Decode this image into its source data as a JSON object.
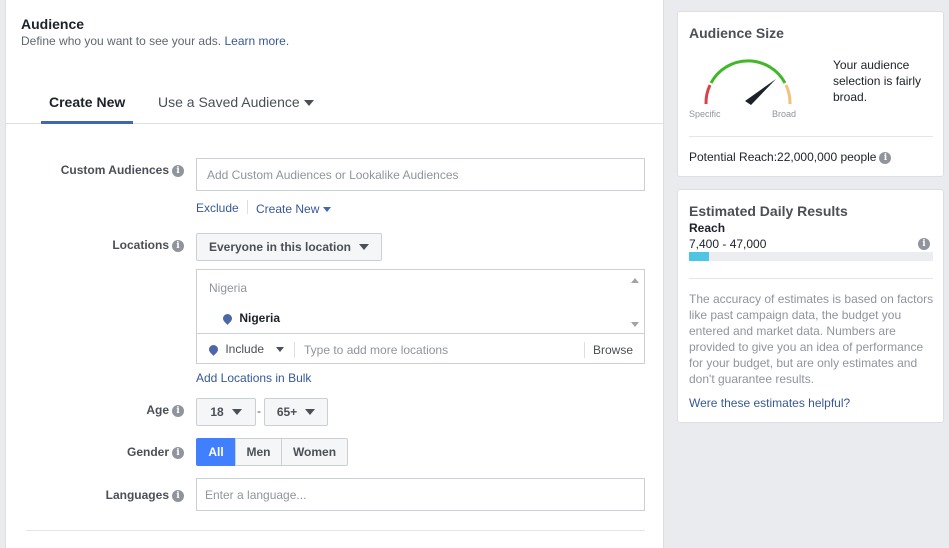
{
  "audience": {
    "title": "Audience",
    "subtitle": "Define who you want to see your ads.",
    "learn_more": "Learn more."
  },
  "tabs": {
    "create_new": "Create New",
    "saved": "Use a Saved Audience"
  },
  "custom_audiences": {
    "label": "Custom Audiences",
    "placeholder": "Add Custom Audiences or Lookalike Audiences",
    "exclude": "Exclude",
    "create_new": "Create New"
  },
  "locations": {
    "label": "Locations",
    "dropdown": "Everyone in this location",
    "country_header": "Nigeria",
    "selected": "Nigeria",
    "include": "Include",
    "placeholder": "Type to add more locations",
    "browse": "Browse",
    "bulk": "Add Locations in Bulk"
  },
  "age": {
    "label": "Age",
    "min": "18",
    "separator": "-",
    "max": "65+"
  },
  "gender": {
    "label": "Gender",
    "options": [
      "All",
      "Men",
      "Women"
    ],
    "selected": "All"
  },
  "languages": {
    "label": "Languages",
    "placeholder": "Enter a language..."
  },
  "audience_size": {
    "title": "Audience Size",
    "specific": "Specific",
    "broad": "Broad",
    "description": "Your audience selection is fairly broad.",
    "potential_reach": "Potential Reach:22,000,000 people"
  },
  "daily_results": {
    "title": "Estimated Daily Results",
    "reach_label": "Reach",
    "reach_range": "7,400 - 47,000",
    "reach_fraction": 0.08,
    "disclaimer": "The accuracy of estimates is based on factors like past campaign data, the budget you entered and market data. Numbers are provided to give you an idea of performance for your budget, but are only estimates and don't guarantee results.",
    "helpful_link": "Were these estimates helpful?"
  },
  "icons": {
    "info": "info-icon",
    "pin": "location-pin-icon",
    "caret": "caret-down-icon"
  },
  "colors": {
    "accent": "#4267b2",
    "active_segment": "#4080ff",
    "gauge_green": "#42b72a",
    "gauge_red": "#d8424a",
    "gauge_orange": "#f0c27b",
    "reach_bar": "#4dc6e6"
  }
}
